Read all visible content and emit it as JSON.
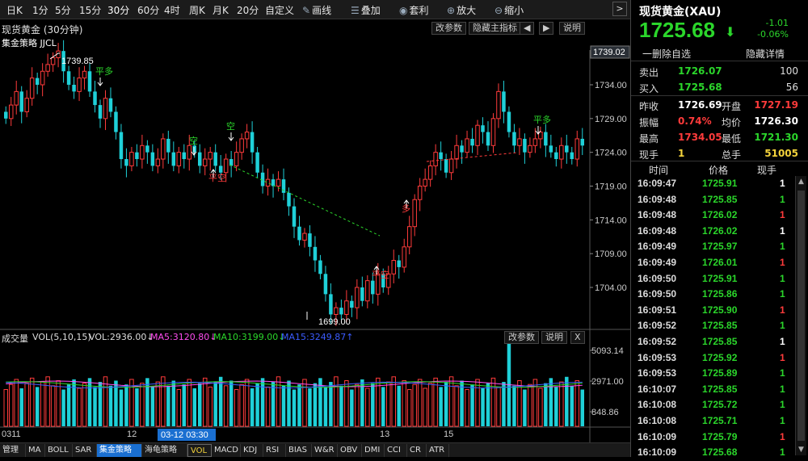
{
  "toolbar": {
    "periods": [
      "日K",
      "1分",
      "5分",
      "15分",
      "30分",
      "60分",
      "4时",
      "周K",
      "月K",
      "20分",
      "自定义"
    ],
    "active_period": "30分",
    "tools": [
      {
        "label": "画线",
        "icon": "pencil-icon"
      },
      {
        "label": "叠加",
        "icon": "stack-icon"
      },
      {
        "label": "套利",
        "icon": "money-bag-icon"
      },
      {
        "label": "放大",
        "icon": "zoom-in-icon"
      },
      {
        "label": "缩小",
        "icon": "zoom-out-icon"
      }
    ],
    "arrow": ">"
  },
  "chart_header": {
    "title": "现货黄金 (30分钟)",
    "buttons": {
      "params": "改参数",
      "hide": "隐藏主指标",
      "prev": "◀",
      "next": "▶",
      "help": "说明"
    }
  },
  "strategy_label": "集金策略 JJCL",
  "price_axis": {
    "labels": [
      "1734.00",
      "1729.00",
      "1724.00",
      "1719.00",
      "1714.00",
      "1709.00",
      "1704.00"
    ],
    "current": "1739.02"
  },
  "annotations": {
    "high": "1739.85",
    "low": "1699.00",
    "signals": [
      "平多",
      "空",
      "平空",
      "空",
      "多",
      "平空",
      "平多"
    ]
  },
  "volume": {
    "label": "成交量",
    "indicator": "VOL(5,10,15)",
    "vol": "VOL:2936.00↓",
    "ma5": "MA5:3120.80↓",
    "ma10": "MA10:3199.00↓",
    "ma15": "MA15:3249.87↑",
    "axis": [
      "5093.14",
      "2971.00",
      "848.86"
    ],
    "buttons": {
      "params": "改参数",
      "help": "说明",
      "close": "X"
    }
  },
  "x_axis": {
    "labels": [
      "0311",
      "12",
      "13",
      "15"
    ],
    "cursor": "03-12 03:30"
  },
  "bottom_tabs": [
    "管理",
    "MA",
    "BOLL",
    "SAR",
    "集金策略",
    "海龟策略",
    "VOL",
    "MACD",
    "KDJ",
    "RSI",
    "BIAS",
    "W&R",
    "OBV",
    "DMI",
    "CCI",
    "CR",
    "ATR"
  ],
  "bottom_tab_active": "集金策略",
  "bottom_tab_highlight": "VOL",
  "quote": {
    "title": "现货黄金(XAU)",
    "price": "1725.68",
    "change": "-1.01",
    "change_pct": "-0.06%",
    "actions": [
      "一删除自选",
      "隐藏详情"
    ],
    "sell_label": "卖出",
    "sell_price": "1726.07",
    "sell_qty": "100",
    "buy_label": "买入",
    "buy_price": "1725.68",
    "buy_qty": "56",
    "stats": [
      {
        "l1": "昨收",
        "v1": "1726.69",
        "l2": "开盘",
        "v2": "1727.19"
      },
      {
        "l1": "振幅",
        "v1": "0.74%",
        "l2": "均价",
        "v2": "1726.30"
      },
      {
        "l1": "最高",
        "v1": "1734.05",
        "l2": "最低",
        "v2": "1721.30"
      },
      {
        "l1": "现手",
        "v1": "1",
        "l2": "总手",
        "v2": "51005"
      }
    ],
    "tick_headers": [
      "时间",
      "价格",
      "现手"
    ],
    "ticks": [
      {
        "t": "16:09:47",
        "p": "1725.91",
        "q": "1",
        "c": "#ffffff"
      },
      {
        "t": "16:09:48",
        "p": "1725.85",
        "q": "1",
        "c": "#2bd62b"
      },
      {
        "t": "16:09:48",
        "p": "1726.02",
        "q": "1",
        "c": "#ff3b3b"
      },
      {
        "t": "16:09:48",
        "p": "1726.02",
        "q": "1",
        "c": "#ffffff"
      },
      {
        "t": "16:09:49",
        "p": "1725.97",
        "q": "1",
        "c": "#2bd62b"
      },
      {
        "t": "16:09:49",
        "p": "1726.01",
        "q": "1",
        "c": "#ff3b3b"
      },
      {
        "t": "16:09:50",
        "p": "1725.91",
        "q": "1",
        "c": "#2bd62b"
      },
      {
        "t": "16:09:50",
        "p": "1725.86",
        "q": "1",
        "c": "#2bd62b"
      },
      {
        "t": "16:09:51",
        "p": "1725.90",
        "q": "1",
        "c": "#ff3b3b"
      },
      {
        "t": "16:09:52",
        "p": "1725.85",
        "q": "1",
        "c": "#2bd62b"
      },
      {
        "t": "16:09:52",
        "p": "1725.85",
        "q": "1",
        "c": "#ffffff"
      },
      {
        "t": "16:09:53",
        "p": "1725.92",
        "q": "1",
        "c": "#ff3b3b"
      },
      {
        "t": "16:09:53",
        "p": "1725.89",
        "q": "1",
        "c": "#2bd62b"
      },
      {
        "t": "16:10:07",
        "p": "1725.85",
        "q": "1",
        "c": "#2bd62b"
      },
      {
        "t": "16:10:08",
        "p": "1725.72",
        "q": "1",
        "c": "#2bd62b"
      },
      {
        "t": "16:10:08",
        "p": "1725.71",
        "q": "1",
        "c": "#2bd62b"
      },
      {
        "t": "16:10:09",
        "p": "1725.79",
        "q": "1",
        "c": "#ff3b3b"
      },
      {
        "t": "16:10:09",
        "p": "1725.68",
        "q": "1",
        "c": "#2bd62b"
      }
    ]
  },
  "colors": {
    "up": "#ff3b3b",
    "down": "#1fd0d8",
    "accent": "#2bd62b",
    "ma5": "#ff4df0",
    "ma10": "#2bd62b",
    "ma15": "#3b5cff"
  }
}
